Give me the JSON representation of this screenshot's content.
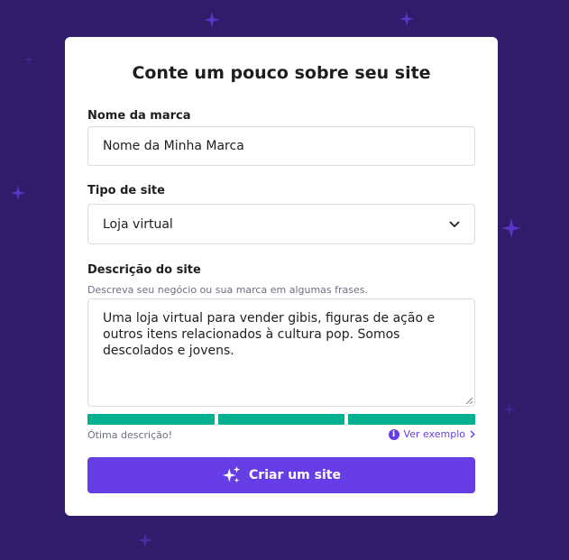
{
  "form": {
    "title": "Conte um pouco sobre seu site",
    "brand_label": "Nome da marca",
    "brand_value": "Nome da Minha Marca",
    "type_label": "Tipo de site",
    "type_value": "Loja virtual",
    "description_label": "Descrição do site",
    "description_hint": "Descreva seu negócio ou sua marca em algumas frases.",
    "description_value": "Uma loja virtual para vender gibis, figuras de ação e outros itens relacionados à cultura pop. Somos descolados e jovens.",
    "quality_label": "Ótima descrição!",
    "quality_level": 1.0,
    "example_link": "Ver exemplo",
    "submit_label": "Criar um site"
  },
  "colors": {
    "background": "#2f1c6a",
    "accent": "#673de6",
    "meter_fill": "#00b090"
  },
  "icons": [
    "sparkle-icon",
    "chevron-down-icon",
    "info-icon",
    "chevron-right-icon",
    "sparkles-icon"
  ]
}
